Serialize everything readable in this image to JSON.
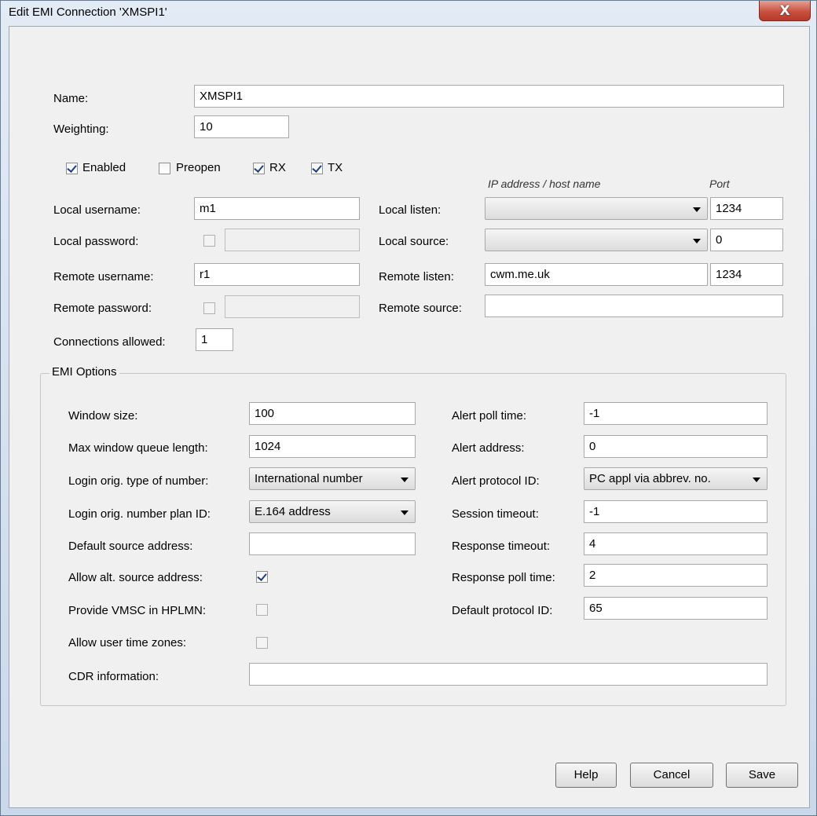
{
  "window": {
    "title": "Edit EMI Connection 'XMSPI1'",
    "close_glyph": "X"
  },
  "general": {
    "name_label": "Name:",
    "name_value": "XMSPI1",
    "weighting_label": "Weighting:",
    "weighting_value": "10",
    "enabled_label": "Enabled",
    "enabled": true,
    "preopen_label": "Preopen",
    "preopen": false,
    "rx_label": "RX",
    "rx": true,
    "tx_label": "TX",
    "tx": true,
    "ip_header": "IP address / host name",
    "port_header": "Port",
    "local_username_label": "Local username:",
    "local_username_value": "m1",
    "local_password_label": "Local password:",
    "remote_username_label": "Remote username:",
    "remote_username_value": "r1",
    "remote_password_label": "Remote password:",
    "connections_label": "Connections allowed:",
    "connections_value": "1",
    "local_listen_label": "Local listen:",
    "local_listen_host": "",
    "local_listen_port": "1234",
    "local_source_label": "Local source:",
    "local_source_host": "",
    "local_source_port": "0",
    "remote_listen_label": "Remote listen:",
    "remote_listen_host": "cwm.me.uk",
    "remote_listen_port": "1234",
    "remote_source_label": "Remote source:",
    "remote_source_host": ""
  },
  "emi": {
    "group_label": "EMI Options",
    "window_size_label": "Window size:",
    "window_size_value": "100",
    "max_queue_label": "Max window queue length:",
    "max_queue_value": "1024",
    "login_ton_label": "Login orig. type of number:",
    "login_ton_value": "International number",
    "login_npi_label": "Login orig. number plan ID:",
    "login_npi_value": "E.164 address",
    "default_source_label": "Default source address:",
    "default_source_value": "",
    "allow_alt_label": "Allow alt. source address:",
    "allow_alt": true,
    "provide_vmsc_label": "Provide VMSC in HPLMN:",
    "provide_vmsc": false,
    "allow_tz_label": "Allow user time zones:",
    "allow_tz": false,
    "cdr_label": "CDR information:",
    "cdr_value": "",
    "alert_poll_label": "Alert poll time:",
    "alert_poll_value": "-1",
    "alert_address_label": "Alert address:",
    "alert_address_value": "0",
    "alert_protocol_label": "Alert protocol ID:",
    "alert_protocol_value": "PC appl via abbrev. no.",
    "session_timeout_label": "Session timeout:",
    "session_timeout_value": "-1",
    "response_timeout_label": "Response timeout:",
    "response_timeout_value": "4",
    "response_poll_label": "Response poll time:",
    "response_poll_value": "2",
    "default_protocol_label": "Default protocol ID:",
    "default_protocol_value": "65"
  },
  "buttons": {
    "help": "Help",
    "cancel": "Cancel",
    "save": "Save"
  }
}
